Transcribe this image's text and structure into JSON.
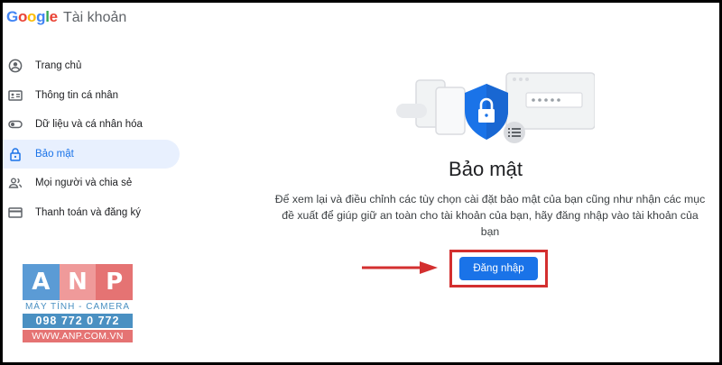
{
  "header": {
    "logo_letters": [
      {
        "char": "G",
        "color": "#4285f4"
      },
      {
        "char": "o",
        "color": "#ea4335"
      },
      {
        "char": "o",
        "color": "#fbbc05"
      },
      {
        "char": "g",
        "color": "#4285f4"
      },
      {
        "char": "l",
        "color": "#34a853"
      },
      {
        "char": "e",
        "color": "#ea4335"
      }
    ],
    "product": "Tài khoản"
  },
  "sidebar": {
    "items": [
      {
        "label": "Trang chủ",
        "icon": "account-circle-icon",
        "active": false
      },
      {
        "label": "Thông tin cá nhân",
        "icon": "id-card-icon",
        "active": false
      },
      {
        "label": "Dữ liệu và cá nhân hóa",
        "icon": "toggle-icon",
        "active": false
      },
      {
        "label": "Bảo mật",
        "icon": "lock-icon",
        "active": true
      },
      {
        "label": "Mọi người và chia sẻ",
        "icon": "people-icon",
        "active": false
      },
      {
        "label": "Thanh toán và đăng ký",
        "icon": "credit-card-icon",
        "active": false
      }
    ]
  },
  "main": {
    "illustration": "security-shield-illustration",
    "title": "Bảo mật",
    "description": "Để xem lại và điều chỉnh các tùy chọn cài đặt bảo mật của bạn cũng như nhận các mục đề xuất để giúp giữ an toàn cho tài khoản của bạn, hãy đăng nhập vào tài khoản của bạn",
    "login_label": "Đăng nhập"
  },
  "watermark": {
    "letters": [
      "A",
      "N",
      "P"
    ],
    "subtitle": "MÁY TÍNH - CAMERA",
    "phone": "098 772 0 772",
    "website": "WWW.ANP.COM.VN",
    "colors": {
      "a": "#5b9bd5",
      "n": "#ef9a9a",
      "p": "#e57373",
      "blue": "#4a90c2",
      "red": "#e57373"
    }
  },
  "colors": {
    "accent": "#1a73e8",
    "active_bg": "#e8f0fe",
    "highlight_border": "#d32f2f",
    "arrow": "#d32f2f"
  }
}
